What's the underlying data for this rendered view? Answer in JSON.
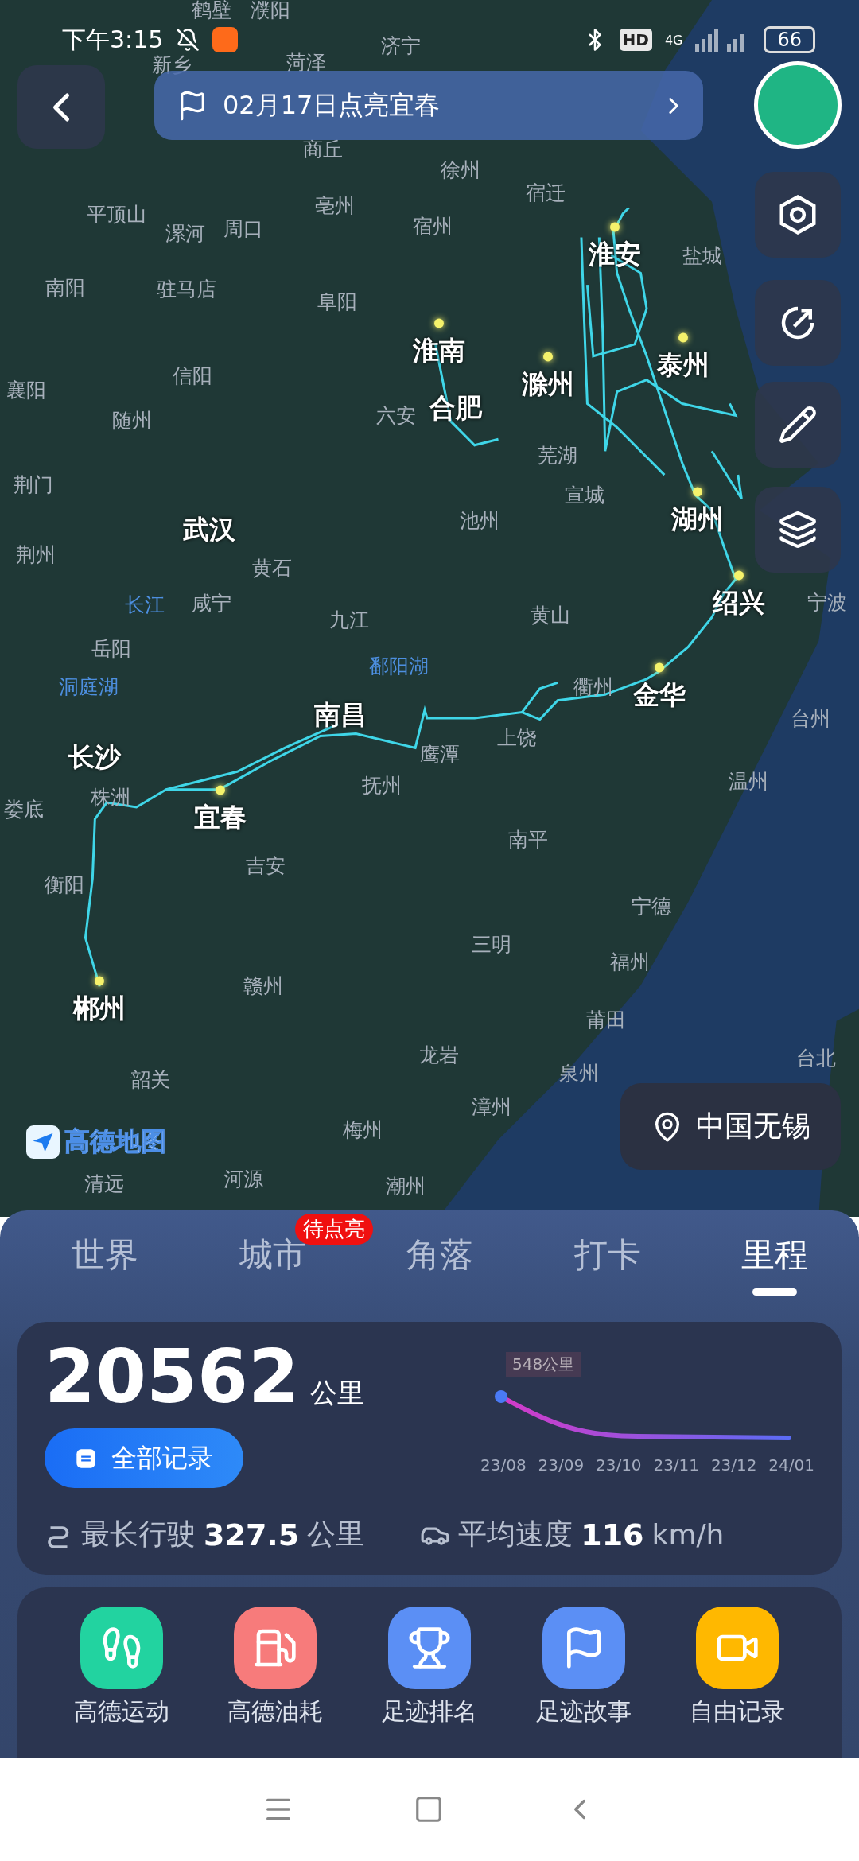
{
  "status_bar": {
    "time": "下午3:15",
    "network": "4G",
    "hd": "HD",
    "battery": "66"
  },
  "banner": {
    "text": "02月17日点亮宜春"
  },
  "map_labels": [
    {
      "text": "鹤壁",
      "kind": "city"
    },
    {
      "text": "濮阳",
      "kind": "city"
    },
    {
      "text": "新乡",
      "kind": "city"
    },
    {
      "text": "菏泽",
      "kind": "city"
    },
    {
      "text": "济宁",
      "kind": "city"
    },
    {
      "text": "商丘",
      "kind": "city"
    },
    {
      "text": "徐州",
      "kind": "city"
    },
    {
      "text": "平顶山",
      "kind": "city"
    },
    {
      "text": "漯河",
      "kind": "city"
    },
    {
      "text": "周口",
      "kind": "city"
    },
    {
      "text": "亳州",
      "kind": "city"
    },
    {
      "text": "宿州",
      "kind": "city"
    },
    {
      "text": "宿迁",
      "kind": "city"
    },
    {
      "text": "淮安",
      "kind": "lit"
    },
    {
      "text": "盐城",
      "kind": "city"
    },
    {
      "text": "南阳",
      "kind": "city"
    },
    {
      "text": "驻马店",
      "kind": "city"
    },
    {
      "text": "阜阳",
      "kind": "city"
    },
    {
      "text": "淮南",
      "kind": "lit"
    },
    {
      "text": "襄阳",
      "kind": "city"
    },
    {
      "text": "信阳",
      "kind": "city"
    },
    {
      "text": "滁州",
      "kind": "lit"
    },
    {
      "text": "泰州",
      "kind": "lit"
    },
    {
      "text": "随州",
      "kind": "city"
    },
    {
      "text": "六安",
      "kind": "city"
    },
    {
      "text": "合肥",
      "kind": "major"
    },
    {
      "text": "芜湖",
      "kind": "city"
    },
    {
      "text": "荆门",
      "kind": "city"
    },
    {
      "text": "宣城",
      "kind": "city"
    },
    {
      "text": "武汉",
      "kind": "major"
    },
    {
      "text": "池州",
      "kind": "city"
    },
    {
      "text": "湖州",
      "kind": "lit"
    },
    {
      "text": "荆州",
      "kind": "city"
    },
    {
      "text": "黄石",
      "kind": "city"
    },
    {
      "text": "长江",
      "kind": "water"
    },
    {
      "text": "咸宁",
      "kind": "city"
    },
    {
      "text": "九江",
      "kind": "city"
    },
    {
      "text": "黄山",
      "kind": "city"
    },
    {
      "text": "绍兴",
      "kind": "lit"
    },
    {
      "text": "宁波",
      "kind": "city"
    },
    {
      "text": "岳阳",
      "kind": "city"
    },
    {
      "text": "洞庭湖",
      "kind": "water"
    },
    {
      "text": "鄱阳湖",
      "kind": "water"
    },
    {
      "text": "衢州",
      "kind": "city"
    },
    {
      "text": "金华",
      "kind": "lit"
    },
    {
      "text": "南昌",
      "kind": "major"
    },
    {
      "text": "长沙",
      "kind": "major"
    },
    {
      "text": "鹰潭",
      "kind": "city"
    },
    {
      "text": "上饶",
      "kind": "city"
    },
    {
      "text": "台州",
      "kind": "city"
    },
    {
      "text": "娄底",
      "kind": "city"
    },
    {
      "text": "株洲",
      "kind": "city"
    },
    {
      "text": "抚州",
      "kind": "city"
    },
    {
      "text": "温州",
      "kind": "city"
    },
    {
      "text": "宜春",
      "kind": "lit"
    },
    {
      "text": "南平",
      "kind": "city"
    },
    {
      "text": "衡阳",
      "kind": "city"
    },
    {
      "text": "吉安",
      "kind": "city"
    },
    {
      "text": "宁德",
      "kind": "city"
    },
    {
      "text": "三明",
      "kind": "city"
    },
    {
      "text": "福州",
      "kind": "city"
    },
    {
      "text": "郴州",
      "kind": "lit"
    },
    {
      "text": "赣州",
      "kind": "city"
    },
    {
      "text": "莆田",
      "kind": "city"
    },
    {
      "text": "龙岩",
      "kind": "city"
    },
    {
      "text": "韶关",
      "kind": "city"
    },
    {
      "text": "泉州",
      "kind": "city"
    },
    {
      "text": "台北",
      "kind": "city"
    },
    {
      "text": "漳州",
      "kind": "city"
    },
    {
      "text": "梅州",
      "kind": "city"
    },
    {
      "text": "清远",
      "kind": "city"
    },
    {
      "text": "河源",
      "kind": "city"
    },
    {
      "text": "潮州",
      "kind": "city"
    }
  ],
  "map_logo": "高德地图",
  "location": "中国无锡",
  "tabs": [
    {
      "label": "世界",
      "selected": false
    },
    {
      "label": "城市",
      "selected": false,
      "badge": "待点亮"
    },
    {
      "label": "角落",
      "selected": false
    },
    {
      "label": "打卡",
      "selected": false
    },
    {
      "label": "里程",
      "selected": true
    }
  ],
  "mileage": {
    "total": "20562",
    "unit": "公里",
    "records_button": "全部记录",
    "chart_peak_label": "548公里",
    "chart_months": [
      "23/08",
      "23/09",
      "23/10",
      "23/11",
      "23/12",
      "24/01"
    ],
    "longest_label": "最长行驶",
    "longest_value": "327.5",
    "longest_unit": "公里",
    "speed_label": "平均速度",
    "speed_value": "116",
    "speed_unit": "km/h"
  },
  "shortcuts": [
    {
      "label": "高德运动",
      "color": "#22d3a0"
    },
    {
      "label": "高德油耗",
      "color": "#f77b7b"
    },
    {
      "label": "足迹排名",
      "color": "#5b8ff5"
    },
    {
      "label": "足迹故事",
      "color": "#5b8ff5"
    },
    {
      "label": "自由记录",
      "color": "#ffb800"
    }
  ]
}
